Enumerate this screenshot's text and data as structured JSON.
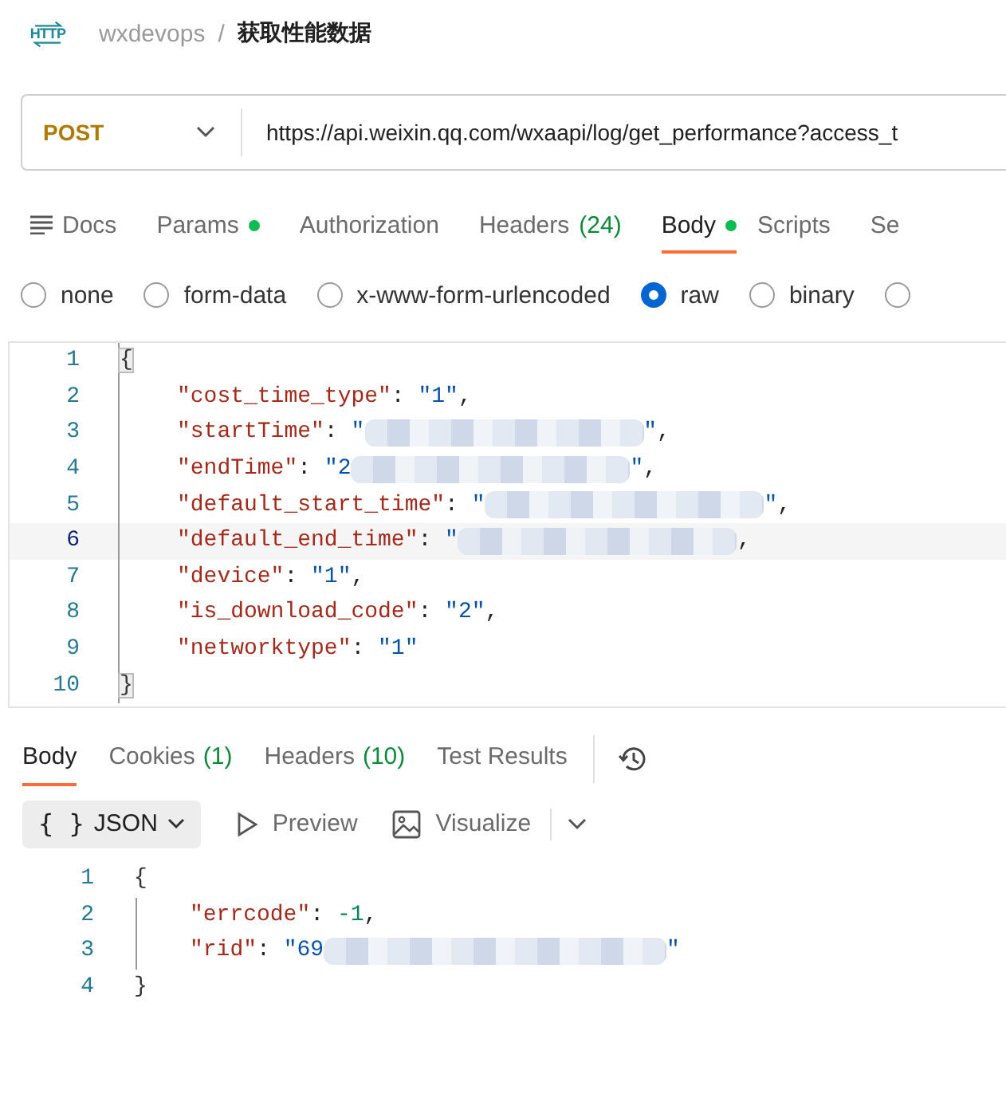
{
  "header": {
    "badge": "HTTP",
    "collection": "wxdevops",
    "separator": "/",
    "request_name": "获取性能数据"
  },
  "url_bar": {
    "method": "POST",
    "url": "https://api.weixin.qq.com/wxaapi/log/get_performance?access_t"
  },
  "request_tabs": [
    {
      "label": "Docs",
      "kind": "docs",
      "selected": false
    },
    {
      "label": "Params",
      "kind": "dot",
      "selected": false
    },
    {
      "label": "Authorization",
      "kind": "plain",
      "selected": false
    },
    {
      "label": "Headers",
      "count": "(24)",
      "kind": "count",
      "selected": false
    },
    {
      "label": "Body",
      "kind": "dot",
      "selected": true
    },
    {
      "label": "Scripts",
      "kind": "plain",
      "selected": false
    },
    {
      "label": "Se",
      "kind": "plain",
      "selected": false
    }
  ],
  "body_types": [
    {
      "label": "none",
      "selected": false
    },
    {
      "label": "form-data",
      "selected": false
    },
    {
      "label": "x-www-form-urlencoded",
      "selected": false
    },
    {
      "label": "raw",
      "selected": true
    },
    {
      "label": "binary",
      "selected": false
    },
    {
      "selected": false
    }
  ],
  "request_body": [
    {
      "number": "1",
      "indented": false,
      "current": false,
      "tokens": [
        {
          "kind": "brace",
          "text": "{"
        }
      ]
    },
    {
      "number": "2",
      "indented": true,
      "current": false,
      "tokens": [
        {
          "kind": "key",
          "text": "\"cost_time_type\""
        },
        {
          "kind": "punct",
          "text": ": "
        },
        {
          "kind": "string",
          "text": "\"1\""
        },
        {
          "kind": "punct",
          "text": ","
        }
      ]
    },
    {
      "number": "3",
      "indented": true,
      "current": false,
      "tokens": [
        {
          "kind": "key",
          "text": "\"startTime\""
        },
        {
          "kind": "punct",
          "text": ": "
        },
        {
          "kind": "string",
          "text": "\""
        },
        {
          "kind": "redacted"
        },
        {
          "kind": "string",
          "text": "\""
        },
        {
          "kind": "punct",
          "text": ","
        }
      ]
    },
    {
      "number": "4",
      "indented": true,
      "current": false,
      "tokens": [
        {
          "kind": "key",
          "text": "\"endTime\""
        },
        {
          "kind": "punct",
          "text": ": "
        },
        {
          "kind": "string",
          "text": "\"2"
        },
        {
          "kind": "redacted"
        },
        {
          "kind": "string",
          "text": "\""
        },
        {
          "kind": "punct",
          "text": ","
        }
      ]
    },
    {
      "number": "5",
      "indented": true,
      "current": false,
      "tokens": [
        {
          "kind": "key",
          "text": "\"default_start_time\""
        },
        {
          "kind": "punct",
          "text": ": "
        },
        {
          "kind": "string",
          "text": "\""
        },
        {
          "kind": "redacted"
        },
        {
          "kind": "string",
          "text": "\""
        },
        {
          "kind": "punct",
          "text": ","
        }
      ]
    },
    {
      "number": "6",
      "indented": true,
      "current": true,
      "tokens": [
        {
          "kind": "key",
          "text": "\"default_end_time\""
        },
        {
          "kind": "punct",
          "text": ": "
        },
        {
          "kind": "string",
          "text": "\""
        },
        {
          "kind": "redacted"
        },
        {
          "kind": "punct",
          "text": ","
        }
      ]
    },
    {
      "number": "7",
      "indented": true,
      "current": false,
      "tokens": [
        {
          "kind": "key",
          "text": "\"device\""
        },
        {
          "kind": "punct",
          "text": ": "
        },
        {
          "kind": "string",
          "text": "\"1\""
        },
        {
          "kind": "punct",
          "text": ","
        }
      ]
    },
    {
      "number": "8",
      "indented": true,
      "current": false,
      "tokens": [
        {
          "kind": "key",
          "text": "\"is_download_code\""
        },
        {
          "kind": "punct",
          "text": ": "
        },
        {
          "kind": "string",
          "text": "\"2\""
        },
        {
          "kind": "punct",
          "text": ","
        }
      ]
    },
    {
      "number": "9",
      "indented": true,
      "current": false,
      "tokens": [
        {
          "kind": "key",
          "text": "\"networktype\""
        },
        {
          "kind": "punct",
          "text": ": "
        },
        {
          "kind": "string",
          "text": "\"1\""
        }
      ]
    },
    {
      "number": "10",
      "indented": false,
      "current": false,
      "tokens": [
        {
          "kind": "brace",
          "text": "}"
        }
      ]
    }
  ],
  "response_tabs": [
    {
      "label": "Body",
      "selected": true
    },
    {
      "label": "Cookies",
      "count": "(1)",
      "selected": false
    },
    {
      "label": "Headers",
      "count": "(10)",
      "selected": false
    },
    {
      "label": "Test Results",
      "selected": false
    }
  ],
  "response_toolbar": {
    "format": "JSON",
    "format_icon": "{ }",
    "preview": "Preview",
    "visualize": "Visualize"
  },
  "response_body": [
    {
      "number": "1",
      "indented": false,
      "tokens": [
        {
          "kind": "brace",
          "text": "{"
        }
      ]
    },
    {
      "number": "2",
      "indented": true,
      "tokens": [
        {
          "kind": "key",
          "text": "\"errcode\""
        },
        {
          "kind": "punct",
          "text": ": "
        },
        {
          "kind": "number",
          "text": "-1"
        },
        {
          "kind": "punct",
          "text": ","
        }
      ]
    },
    {
      "number": "3",
      "indented": true,
      "tokens": [
        {
          "kind": "key",
          "text": "\"rid\""
        },
        {
          "kind": "punct",
          "text": ": "
        },
        {
          "kind": "string",
          "text": "\"69"
        },
        {
          "kind": "redacted"
        },
        {
          "kind": "string",
          "text": "\""
        }
      ]
    },
    {
      "number": "4",
      "indented": false,
      "tokens": [
        {
          "kind": "brace",
          "text": "}"
        }
      ]
    }
  ]
}
